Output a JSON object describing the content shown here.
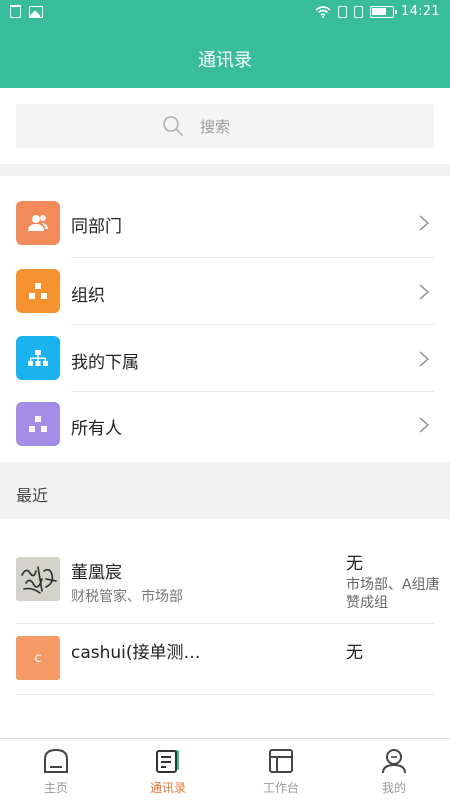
{
  "status_bar": {
    "time": "14:21",
    "icons": [
      "trash-icon",
      "image-icon",
      "wifi-icon",
      "sim-icon",
      "sim-icon",
      "battery-icon"
    ]
  },
  "header": {
    "title": "通讯录"
  },
  "search": {
    "placeholder": "搜索",
    "icon": "search-icon"
  },
  "menu": {
    "items": [
      {
        "label": "同部门",
        "icon": "person-group-icon",
        "color": "#F18B5C"
      },
      {
        "label": "组织",
        "icon": "org-tree-icon",
        "color": "#F5922F"
      },
      {
        "label": "我的下属",
        "icon": "hierarchy-icon",
        "color": "#1AB3F0"
      },
      {
        "label": "所有人",
        "icon": "org-tree-icon",
        "color": "#A58CE6"
      }
    ]
  },
  "recent": {
    "label": "最近",
    "contacts": [
      {
        "name": "董凰宸",
        "sub": "财税管家、市场部",
        "right_title": "无",
        "right_sub": "市场部、A组唐赞成组",
        "avatar_type": "signature-image"
      },
      {
        "name": "cashui(接单测…",
        "sub": "",
        "right_title": "无",
        "right_sub": "",
        "avatar_letter": "c",
        "avatar_color": "#F59A66"
      }
    ]
  },
  "bottom_nav": {
    "items": [
      {
        "label": "主页",
        "icon": "home-icon",
        "active": false
      },
      {
        "label": "通讯录",
        "icon": "contacts-icon",
        "active": true
      },
      {
        "label": "工作台",
        "icon": "workbench-icon",
        "active": false
      },
      {
        "label": "我的",
        "icon": "profile-icon",
        "active": false
      }
    ]
  },
  "colors": {
    "brand": "#38BC99",
    "active_nav": "#E8793A"
  }
}
